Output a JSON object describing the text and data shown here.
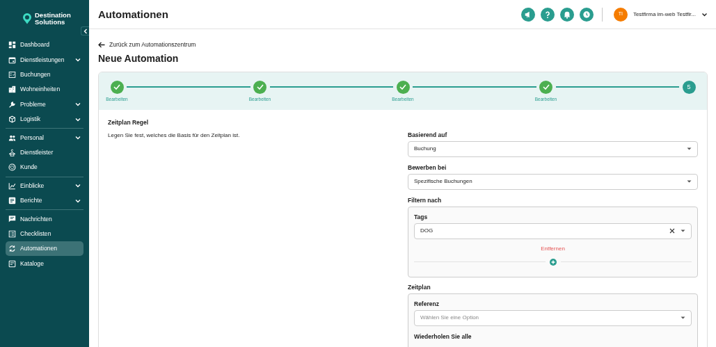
{
  "sidebar": {
    "logo": {
      "line1": "Destination",
      "line2": "Solutions"
    },
    "sections": [
      {
        "items": [
          {
            "label": "Dashboard",
            "expandable": false,
            "selected": false
          },
          {
            "label": "Dienstleistungen",
            "expandable": true,
            "selected": false
          },
          {
            "label": "Buchungen",
            "expandable": false,
            "selected": false
          },
          {
            "label": "Wohneinheiten",
            "expandable": false,
            "selected": false
          },
          {
            "label": "Probleme",
            "expandable": true,
            "selected": false
          },
          {
            "label": "Logistik",
            "expandable": true,
            "selected": false
          }
        ]
      },
      {
        "items": [
          {
            "label": "Personal",
            "expandable": true,
            "selected": false
          },
          {
            "label": "Dienstleister",
            "expandable": false,
            "selected": false
          },
          {
            "label": "Kunde",
            "expandable": false,
            "selected": false
          }
        ]
      },
      {
        "items": [
          {
            "label": "Einblicke",
            "expandable": true,
            "selected": false
          },
          {
            "label": "Berichte",
            "expandable": true,
            "selected": false
          }
        ]
      },
      {
        "items": [
          {
            "label": "Nachrichten",
            "expandable": false,
            "selected": false
          },
          {
            "label": "Checklisten",
            "expandable": false,
            "selected": false
          },
          {
            "label": "Automationen",
            "expandable": false,
            "selected": true
          },
          {
            "label": "Kataloge",
            "expandable": false,
            "selected": false
          }
        ]
      }
    ]
  },
  "header": {
    "title": "Automationen",
    "user": {
      "initials": "TI",
      "name": "Testfirma im-web Testfir..."
    }
  },
  "back_link": "Zurück zum Automationszentrum",
  "page_title": "Neue Automation",
  "steps": [
    {
      "done": true,
      "label": "Bearbeiten"
    },
    {
      "done": true,
      "label": "Bearbeiten"
    },
    {
      "done": true,
      "label": "Bearbeiten"
    },
    {
      "done": true,
      "label": "Bearbeiten"
    },
    {
      "done": false,
      "number": "5"
    }
  ],
  "section": {
    "title": "Zeitplan Regel",
    "description": "Legen Sie fest, welches die Basis für den Zeitplan ist."
  },
  "fields": [
    {
      "label": "Basierend auf",
      "value": "Buchung"
    },
    {
      "label": "Bewerben bei",
      "value": "Spezifische Buchungen"
    }
  ],
  "filter": {
    "label": "Filtern nach",
    "tags_label": "Tags",
    "tags_value": "DOG",
    "remove": "Entfernen"
  },
  "schedule": {
    "label": "Zeitplan",
    "reference_label": "Referenz",
    "reference_placeholder": "Wählen Sie eine Option",
    "repeat_label": "Wiederholen Sie alle"
  }
}
